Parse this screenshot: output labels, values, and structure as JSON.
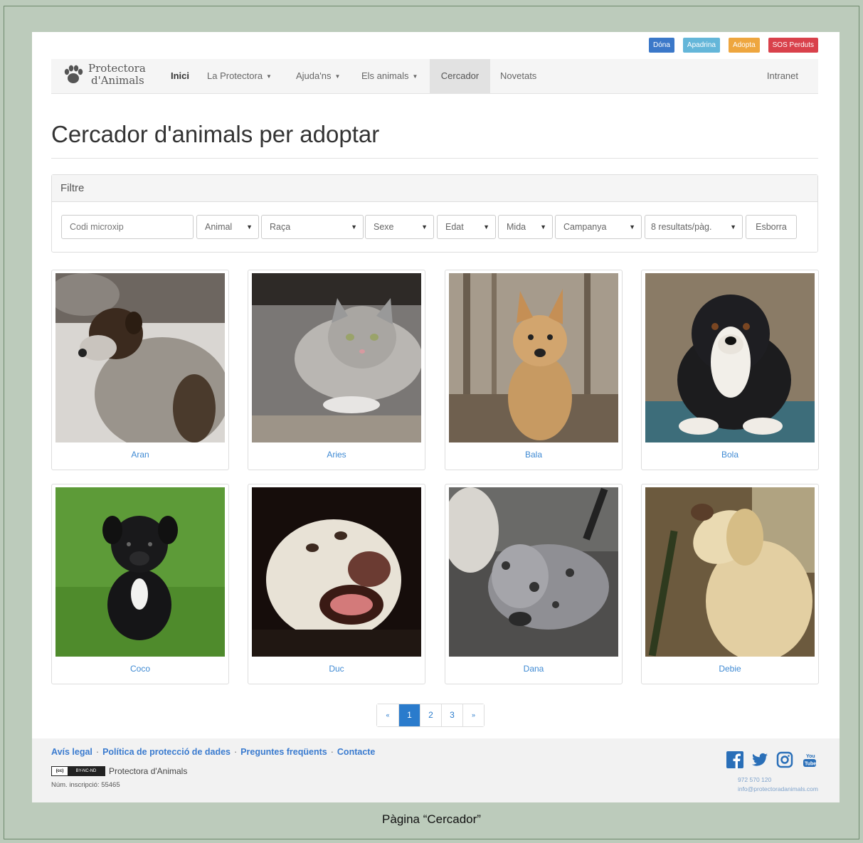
{
  "top_buttons": [
    {
      "label": "Dóna",
      "color": "#3b78c9"
    },
    {
      "label": "Apadrina",
      "color": "#64b6d9"
    },
    {
      "label": "Adopta",
      "color": "#eea63f"
    },
    {
      "label": "SOS Perduts",
      "color": "#d9414b"
    }
  ],
  "logo": {
    "line1": "Protectora",
    "line2": "d'Animals",
    "icon": "paw-icon"
  },
  "nav": {
    "inici": "Inici",
    "la_protectora": "La Protectora",
    "ajudans": "Ajuda'ns",
    "els_animals": "Els animals",
    "cercador": "Cercador",
    "novetats": "Novetats",
    "intranet": "Intranet"
  },
  "page_title": "Cercador d'animals per adoptar",
  "filter": {
    "title": "Filtre",
    "microchip_placeholder": "Codi microxip",
    "animal": "Animal",
    "raca": "Raça",
    "sexe": "Sexe",
    "edat": "Edat",
    "mida": "Mida",
    "campanya": "Campanya",
    "per_page": "8 resultats/pàg.",
    "clear": "Esborra"
  },
  "animals": [
    {
      "name": "Aran"
    },
    {
      "name": "Aries"
    },
    {
      "name": "Bala"
    },
    {
      "name": "Bola"
    },
    {
      "name": "Coco"
    },
    {
      "name": "Duc"
    },
    {
      "name": "Dana"
    },
    {
      "name": "Debie"
    }
  ],
  "pagination": {
    "prev": "«",
    "pages": [
      "1",
      "2",
      "3"
    ],
    "next": "»",
    "current": "1"
  },
  "footer": {
    "links": [
      "Avís legal",
      "Política de protecció de dades",
      "Preguntes freqüents",
      "Contacte"
    ],
    "license_badge": "BY-NC-ND",
    "org": "Protectora d'Animals",
    "registration": "Núm. inscripció: 55465",
    "social": [
      "facebook-icon",
      "twitter-icon",
      "instagram-icon",
      "youtube-icon"
    ],
    "phone": "972 570 120",
    "email": "info@protectoradanimals.com"
  },
  "caption": "Pàgina “Cercador”"
}
